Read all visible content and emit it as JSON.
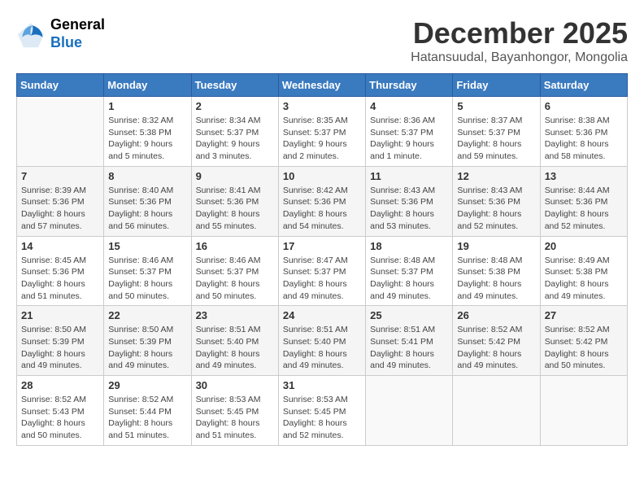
{
  "logo": {
    "general": "General",
    "blue": "Blue"
  },
  "title": "December 2025",
  "location": "Hatansuudal, Bayanhongor, Mongolia",
  "days_of_week": [
    "Sunday",
    "Monday",
    "Tuesday",
    "Wednesday",
    "Thursday",
    "Friday",
    "Saturday"
  ],
  "weeks": [
    [
      {
        "day": "",
        "info": ""
      },
      {
        "day": "1",
        "info": "Sunrise: 8:32 AM\nSunset: 5:38 PM\nDaylight: 9 hours\nand 5 minutes."
      },
      {
        "day": "2",
        "info": "Sunrise: 8:34 AM\nSunset: 5:37 PM\nDaylight: 9 hours\nand 3 minutes."
      },
      {
        "day": "3",
        "info": "Sunrise: 8:35 AM\nSunset: 5:37 PM\nDaylight: 9 hours\nand 2 minutes."
      },
      {
        "day": "4",
        "info": "Sunrise: 8:36 AM\nSunset: 5:37 PM\nDaylight: 9 hours\nand 1 minute."
      },
      {
        "day": "5",
        "info": "Sunrise: 8:37 AM\nSunset: 5:37 PM\nDaylight: 8 hours\nand 59 minutes."
      },
      {
        "day": "6",
        "info": "Sunrise: 8:38 AM\nSunset: 5:36 PM\nDaylight: 8 hours\nand 58 minutes."
      }
    ],
    [
      {
        "day": "7",
        "info": "Sunrise: 8:39 AM\nSunset: 5:36 PM\nDaylight: 8 hours\nand 57 minutes."
      },
      {
        "day": "8",
        "info": "Sunrise: 8:40 AM\nSunset: 5:36 PM\nDaylight: 8 hours\nand 56 minutes."
      },
      {
        "day": "9",
        "info": "Sunrise: 8:41 AM\nSunset: 5:36 PM\nDaylight: 8 hours\nand 55 minutes."
      },
      {
        "day": "10",
        "info": "Sunrise: 8:42 AM\nSunset: 5:36 PM\nDaylight: 8 hours\nand 54 minutes."
      },
      {
        "day": "11",
        "info": "Sunrise: 8:43 AM\nSunset: 5:36 PM\nDaylight: 8 hours\nand 53 minutes."
      },
      {
        "day": "12",
        "info": "Sunrise: 8:43 AM\nSunset: 5:36 PM\nDaylight: 8 hours\nand 52 minutes."
      },
      {
        "day": "13",
        "info": "Sunrise: 8:44 AM\nSunset: 5:36 PM\nDaylight: 8 hours\nand 52 minutes."
      }
    ],
    [
      {
        "day": "14",
        "info": "Sunrise: 8:45 AM\nSunset: 5:36 PM\nDaylight: 8 hours\nand 51 minutes."
      },
      {
        "day": "15",
        "info": "Sunrise: 8:46 AM\nSunset: 5:37 PM\nDaylight: 8 hours\nand 50 minutes."
      },
      {
        "day": "16",
        "info": "Sunrise: 8:46 AM\nSunset: 5:37 PM\nDaylight: 8 hours\nand 50 minutes."
      },
      {
        "day": "17",
        "info": "Sunrise: 8:47 AM\nSunset: 5:37 PM\nDaylight: 8 hours\nand 49 minutes."
      },
      {
        "day": "18",
        "info": "Sunrise: 8:48 AM\nSunset: 5:37 PM\nDaylight: 8 hours\nand 49 minutes."
      },
      {
        "day": "19",
        "info": "Sunrise: 8:48 AM\nSunset: 5:38 PM\nDaylight: 8 hours\nand 49 minutes."
      },
      {
        "day": "20",
        "info": "Sunrise: 8:49 AM\nSunset: 5:38 PM\nDaylight: 8 hours\nand 49 minutes."
      }
    ],
    [
      {
        "day": "21",
        "info": "Sunrise: 8:50 AM\nSunset: 5:39 PM\nDaylight: 8 hours\nand 49 minutes."
      },
      {
        "day": "22",
        "info": "Sunrise: 8:50 AM\nSunset: 5:39 PM\nDaylight: 8 hours\nand 49 minutes."
      },
      {
        "day": "23",
        "info": "Sunrise: 8:51 AM\nSunset: 5:40 PM\nDaylight: 8 hours\nand 49 minutes."
      },
      {
        "day": "24",
        "info": "Sunrise: 8:51 AM\nSunset: 5:40 PM\nDaylight: 8 hours\nand 49 minutes."
      },
      {
        "day": "25",
        "info": "Sunrise: 8:51 AM\nSunset: 5:41 PM\nDaylight: 8 hours\nand 49 minutes."
      },
      {
        "day": "26",
        "info": "Sunrise: 8:52 AM\nSunset: 5:42 PM\nDaylight: 8 hours\nand 49 minutes."
      },
      {
        "day": "27",
        "info": "Sunrise: 8:52 AM\nSunset: 5:42 PM\nDaylight: 8 hours\nand 50 minutes."
      }
    ],
    [
      {
        "day": "28",
        "info": "Sunrise: 8:52 AM\nSunset: 5:43 PM\nDaylight: 8 hours\nand 50 minutes."
      },
      {
        "day": "29",
        "info": "Sunrise: 8:52 AM\nSunset: 5:44 PM\nDaylight: 8 hours\nand 51 minutes."
      },
      {
        "day": "30",
        "info": "Sunrise: 8:53 AM\nSunset: 5:45 PM\nDaylight: 8 hours\nand 51 minutes."
      },
      {
        "day": "31",
        "info": "Sunrise: 8:53 AM\nSunset: 5:45 PM\nDaylight: 8 hours\nand 52 minutes."
      },
      {
        "day": "",
        "info": ""
      },
      {
        "day": "",
        "info": ""
      },
      {
        "day": "",
        "info": ""
      }
    ]
  ]
}
